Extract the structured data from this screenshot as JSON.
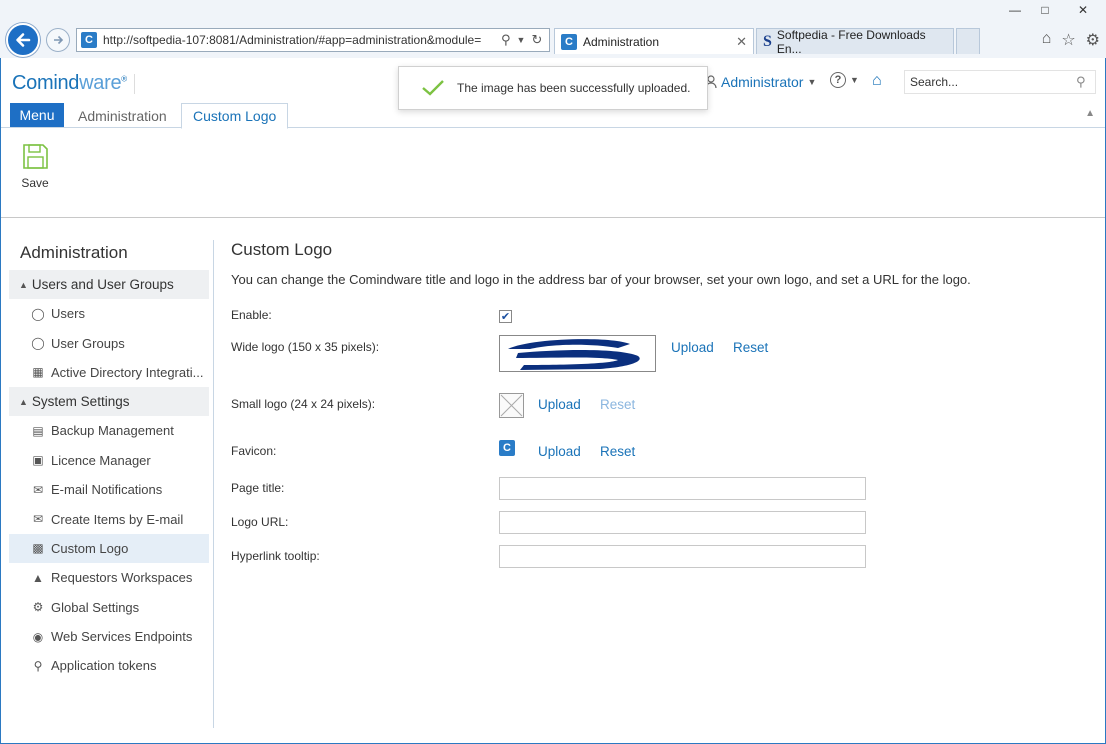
{
  "browser": {
    "address": "http://softpedia-107:8081/Administration/#app=administration&module=",
    "tabs": [
      {
        "label": "Administration",
        "active": true
      },
      {
        "label": "Softpedia - Free Downloads En...",
        "active": false
      }
    ]
  },
  "header": {
    "logo_main": "Comind",
    "logo_accent": "ware",
    "user": "Administrator",
    "search_placeholder": "Search..."
  },
  "app_tabs": {
    "menu": "Menu",
    "administration": "Administration",
    "custom_logo": "Custom Logo"
  },
  "toast": {
    "message": "The image has been successfully uploaded."
  },
  "toolbar": {
    "save_label": "Save"
  },
  "sidebar": {
    "title": "Administration",
    "groups": [
      {
        "label": "Users and User Groups",
        "items": [
          {
            "label": "Users",
            "icon": "user-icon"
          },
          {
            "label": "User Groups",
            "icon": "users-icon"
          },
          {
            "label": "Active Directory Integrati...",
            "icon": "directory-icon"
          }
        ]
      },
      {
        "label": "System Settings",
        "items": [
          {
            "label": "Backup Management",
            "icon": "backup-icon"
          },
          {
            "label": "Licence Manager",
            "icon": "licence-icon"
          },
          {
            "label": "E-mail Notifications",
            "icon": "mail-icon"
          },
          {
            "label": "Create Items by E-mail",
            "icon": "mail-create-icon"
          },
          {
            "label": "Custom Logo",
            "icon": "logo-icon",
            "selected": true
          },
          {
            "label": "Requestors Workspaces",
            "icon": "workspace-icon"
          },
          {
            "label": "Global Settings",
            "icon": "gear-icon"
          },
          {
            "label": "Web Services Endpoints",
            "icon": "globe-icon"
          },
          {
            "label": "Application tokens",
            "icon": "token-icon"
          }
        ]
      }
    ]
  },
  "main": {
    "title": "Custom Logo",
    "description": "You can change the Comindware title and logo in the address bar of your browser, set your own logo, and set a URL for the logo.",
    "enable_label": "Enable:",
    "enable_checked": true,
    "wide_logo_label": "Wide logo (150 x 35 pixels):",
    "small_logo_label": "Small logo (24 x 24 pixels):",
    "favicon_label": "Favicon:",
    "upload": "Upload",
    "reset": "Reset",
    "page_title_label": "Page title:",
    "page_title_value": "",
    "logo_url_label": "Logo URL:",
    "logo_url_value": "",
    "hyperlink_tooltip_label": "Hyperlink tooltip:",
    "hyperlink_tooltip_value": ""
  },
  "colors": {
    "accent": "#1e6fc5",
    "success": "#7cc242"
  }
}
